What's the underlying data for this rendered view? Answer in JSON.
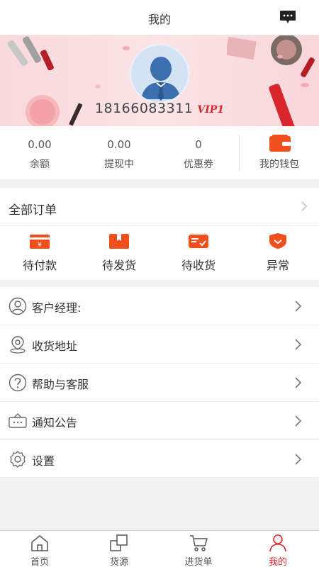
{
  "header": {
    "title": "我的"
  },
  "profile": {
    "phone": "18166083311",
    "vip": "VIP1"
  },
  "stats": [
    {
      "value": "0.00",
      "label": "余额"
    },
    {
      "value": "0.00",
      "label": "提现中"
    },
    {
      "value": "0",
      "label": "优惠券"
    }
  ],
  "wallet": {
    "label": "我的钱包"
  },
  "orders": {
    "all_label": "全部订单",
    "items": [
      {
        "label": "待付款",
        "icon": "wallet-yen-icon"
      },
      {
        "label": "待发货",
        "icon": "box-icon"
      },
      {
        "label": "待收货",
        "icon": "truck-check-icon"
      },
      {
        "label": "异常",
        "icon": "shield-alert-icon"
      }
    ]
  },
  "menu": [
    {
      "label": "客户经理:",
      "icon": "user-circle-icon"
    },
    {
      "label": "收货地址",
      "icon": "location-pin-icon"
    },
    {
      "label": "帮助与客服",
      "icon": "help-circle-icon"
    },
    {
      "label": "通知公告",
      "icon": "notice-icon"
    },
    {
      "label": "设置",
      "icon": "gear-icon"
    }
  ],
  "tabs": [
    {
      "label": "首页",
      "icon": "home-icon"
    },
    {
      "label": "货源",
      "icon": "source-icon"
    },
    {
      "label": "进货单",
      "icon": "cart-icon"
    },
    {
      "label": "我的",
      "icon": "user-icon",
      "active": true
    }
  ],
  "colors": {
    "accent": "#d9262c",
    "orange": "#f0501e",
    "banner": "#f9d9dc"
  }
}
